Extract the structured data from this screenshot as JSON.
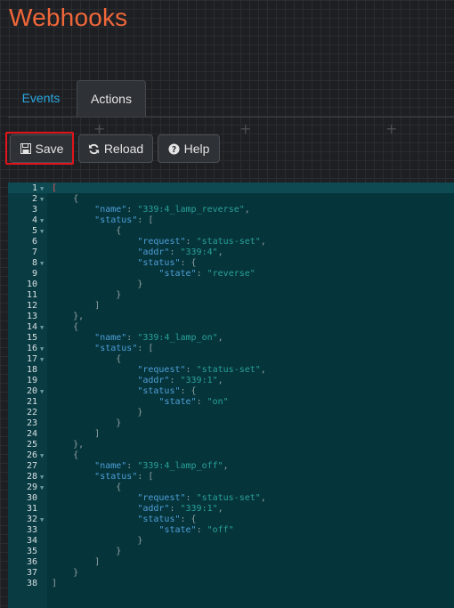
{
  "header": {
    "title": "Webhooks"
  },
  "tabs": [
    {
      "label": "Events",
      "active": false
    },
    {
      "label": "Actions",
      "active": true
    }
  ],
  "toolbar": {
    "save_label": "Save",
    "reload_label": "Reload",
    "help_label": "Help"
  },
  "editor": {
    "lines": [
      {
        "n": "1",
        "fold": true,
        "segs": [
          {
            "t": "[",
            "c": "cursor-bracket"
          }
        ]
      },
      {
        "n": "2",
        "fold": true,
        "segs": [
          {
            "t": "    {",
            "c": "p"
          }
        ]
      },
      {
        "n": "3",
        "fold": false,
        "segs": [
          {
            "t": "        ",
            "c": "p"
          },
          {
            "t": "\"name\"",
            "c": "k"
          },
          {
            "t": ": ",
            "c": "p"
          },
          {
            "t": "\"339:4_lamp_reverse\"",
            "c": "s"
          },
          {
            "t": ",",
            "c": "p"
          }
        ]
      },
      {
        "n": "4",
        "fold": true,
        "segs": [
          {
            "t": "        ",
            "c": "p"
          },
          {
            "t": "\"status\"",
            "c": "k"
          },
          {
            "t": ": [",
            "c": "p"
          }
        ]
      },
      {
        "n": "5",
        "fold": true,
        "segs": [
          {
            "t": "            {",
            "c": "p"
          }
        ]
      },
      {
        "n": "6",
        "fold": false,
        "segs": [
          {
            "t": "                ",
            "c": "p"
          },
          {
            "t": "\"request\"",
            "c": "k"
          },
          {
            "t": ": ",
            "c": "p"
          },
          {
            "t": "\"status-set\"",
            "c": "s"
          },
          {
            "t": ",",
            "c": "p"
          }
        ]
      },
      {
        "n": "7",
        "fold": false,
        "segs": [
          {
            "t": "                ",
            "c": "p"
          },
          {
            "t": "\"addr\"",
            "c": "k"
          },
          {
            "t": ": ",
            "c": "p"
          },
          {
            "t": "\"339:4\"",
            "c": "s"
          },
          {
            "t": ",",
            "c": "p"
          }
        ]
      },
      {
        "n": "8",
        "fold": true,
        "segs": [
          {
            "t": "                ",
            "c": "p"
          },
          {
            "t": "\"status\"",
            "c": "k"
          },
          {
            "t": ": {",
            "c": "p"
          }
        ]
      },
      {
        "n": "9",
        "fold": false,
        "segs": [
          {
            "t": "                    ",
            "c": "p"
          },
          {
            "t": "\"state\"",
            "c": "k"
          },
          {
            "t": ": ",
            "c": "p"
          },
          {
            "t": "\"reverse\"",
            "c": "s"
          }
        ]
      },
      {
        "n": "10",
        "fold": false,
        "segs": [
          {
            "t": "                }",
            "c": "p"
          }
        ]
      },
      {
        "n": "11",
        "fold": false,
        "segs": [
          {
            "t": "            }",
            "c": "p"
          }
        ]
      },
      {
        "n": "12",
        "fold": false,
        "segs": [
          {
            "t": "        ]",
            "c": "p"
          }
        ]
      },
      {
        "n": "13",
        "fold": false,
        "segs": [
          {
            "t": "    },",
            "c": "p"
          }
        ]
      },
      {
        "n": "14",
        "fold": true,
        "segs": [
          {
            "t": "    {",
            "c": "p"
          }
        ]
      },
      {
        "n": "15",
        "fold": false,
        "segs": [
          {
            "t": "        ",
            "c": "p"
          },
          {
            "t": "\"name\"",
            "c": "k"
          },
          {
            "t": ": ",
            "c": "p"
          },
          {
            "t": "\"339:4_lamp_on\"",
            "c": "s"
          },
          {
            "t": ",",
            "c": "p"
          }
        ]
      },
      {
        "n": "16",
        "fold": true,
        "segs": [
          {
            "t": "        ",
            "c": "p"
          },
          {
            "t": "\"status\"",
            "c": "k"
          },
          {
            "t": ": [",
            "c": "p"
          }
        ]
      },
      {
        "n": "17",
        "fold": true,
        "segs": [
          {
            "t": "            {",
            "c": "p"
          }
        ]
      },
      {
        "n": "18",
        "fold": false,
        "segs": [
          {
            "t": "                ",
            "c": "p"
          },
          {
            "t": "\"request\"",
            "c": "k"
          },
          {
            "t": ": ",
            "c": "p"
          },
          {
            "t": "\"status-set\"",
            "c": "s"
          },
          {
            "t": ",",
            "c": "p"
          }
        ]
      },
      {
        "n": "19",
        "fold": false,
        "segs": [
          {
            "t": "                ",
            "c": "p"
          },
          {
            "t": "\"addr\"",
            "c": "k"
          },
          {
            "t": ": ",
            "c": "p"
          },
          {
            "t": "\"339:1\"",
            "c": "s"
          },
          {
            "t": ",",
            "c": "p"
          }
        ]
      },
      {
        "n": "20",
        "fold": true,
        "segs": [
          {
            "t": "                ",
            "c": "p"
          },
          {
            "t": "\"status\"",
            "c": "k"
          },
          {
            "t": ": {",
            "c": "p"
          }
        ]
      },
      {
        "n": "21",
        "fold": false,
        "segs": [
          {
            "t": "                    ",
            "c": "p"
          },
          {
            "t": "\"state\"",
            "c": "k"
          },
          {
            "t": ": ",
            "c": "p"
          },
          {
            "t": "\"on\"",
            "c": "s"
          }
        ]
      },
      {
        "n": "22",
        "fold": false,
        "segs": [
          {
            "t": "                }",
            "c": "p"
          }
        ]
      },
      {
        "n": "23",
        "fold": false,
        "segs": [
          {
            "t": "            }",
            "c": "p"
          }
        ]
      },
      {
        "n": "24",
        "fold": false,
        "segs": [
          {
            "t": "        ]",
            "c": "p"
          }
        ]
      },
      {
        "n": "25",
        "fold": false,
        "segs": [
          {
            "t": "    },",
            "c": "p"
          }
        ]
      },
      {
        "n": "26",
        "fold": true,
        "segs": [
          {
            "t": "    {",
            "c": "p"
          }
        ]
      },
      {
        "n": "27",
        "fold": false,
        "segs": [
          {
            "t": "        ",
            "c": "p"
          },
          {
            "t": "\"name\"",
            "c": "k"
          },
          {
            "t": ": ",
            "c": "p"
          },
          {
            "t": "\"339:4_lamp_off\"",
            "c": "s"
          },
          {
            "t": ",",
            "c": "p"
          }
        ]
      },
      {
        "n": "28",
        "fold": true,
        "segs": [
          {
            "t": "        ",
            "c": "p"
          },
          {
            "t": "\"status\"",
            "c": "k"
          },
          {
            "t": ": [",
            "c": "p"
          }
        ]
      },
      {
        "n": "29",
        "fold": true,
        "segs": [
          {
            "t": "            {",
            "c": "p"
          }
        ]
      },
      {
        "n": "30",
        "fold": false,
        "segs": [
          {
            "t": "                ",
            "c": "p"
          },
          {
            "t": "\"request\"",
            "c": "k"
          },
          {
            "t": ": ",
            "c": "p"
          },
          {
            "t": "\"status-set\"",
            "c": "s"
          },
          {
            "t": ",",
            "c": "p"
          }
        ]
      },
      {
        "n": "31",
        "fold": false,
        "segs": [
          {
            "t": "                ",
            "c": "p"
          },
          {
            "t": "\"addr\"",
            "c": "k"
          },
          {
            "t": ": ",
            "c": "p"
          },
          {
            "t": "\"339:1\"",
            "c": "s"
          },
          {
            "t": ",",
            "c": "p"
          }
        ]
      },
      {
        "n": "32",
        "fold": true,
        "segs": [
          {
            "t": "                ",
            "c": "p"
          },
          {
            "t": "\"status\"",
            "c": "k"
          },
          {
            "t": ": {",
            "c": "p"
          }
        ]
      },
      {
        "n": "33",
        "fold": false,
        "segs": [
          {
            "t": "                    ",
            "c": "p"
          },
          {
            "t": "\"state\"",
            "c": "k"
          },
          {
            "t": ": ",
            "c": "p"
          },
          {
            "t": "\"off\"",
            "c": "s"
          }
        ]
      },
      {
        "n": "34",
        "fold": false,
        "segs": [
          {
            "t": "                }",
            "c": "p"
          }
        ]
      },
      {
        "n": "35",
        "fold": false,
        "segs": [
          {
            "t": "            }",
            "c": "p"
          }
        ]
      },
      {
        "n": "36",
        "fold": false,
        "segs": [
          {
            "t": "        ]",
            "c": "p"
          }
        ]
      },
      {
        "n": "37",
        "fold": false,
        "segs": [
          {
            "t": "    }",
            "c": "p"
          }
        ]
      },
      {
        "n": "38",
        "fold": false,
        "segs": [
          {
            "t": "]",
            "c": "p"
          }
        ]
      }
    ]
  }
}
